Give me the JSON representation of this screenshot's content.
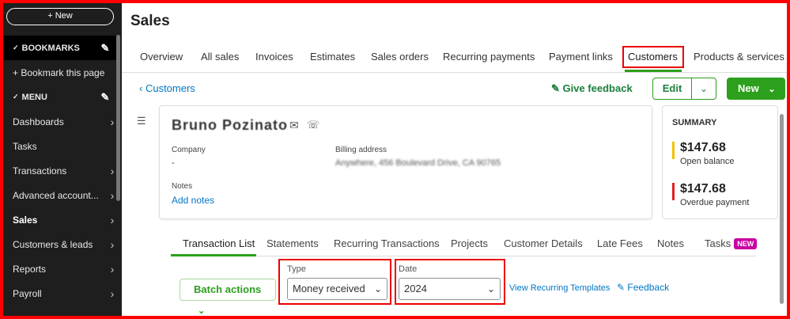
{
  "sidebar": {
    "new_label": "+ New",
    "bookmarks_label": "BOOKMARKS",
    "bookmark_page_label": "+ Bookmark this page",
    "menu_label": "MENU",
    "items": [
      {
        "label": "Dashboards",
        "chevron": true
      },
      {
        "label": "Tasks",
        "chevron": false
      },
      {
        "label": "Transactions",
        "chevron": true
      },
      {
        "label": "Advanced account...",
        "chevron": true
      },
      {
        "label": "Sales",
        "chevron": true,
        "active": true
      },
      {
        "label": "Customers & leads",
        "chevron": true
      },
      {
        "label": "Reports",
        "chevron": true
      },
      {
        "label": "Payroll",
        "chevron": true
      }
    ]
  },
  "page": {
    "title": "Sales"
  },
  "tabs": [
    "Overview",
    "All sales",
    "Invoices",
    "Estimates",
    "Sales orders",
    "Recurring payments",
    "Payment links",
    "Customers",
    "Products & services"
  ],
  "active_tab": "Customers",
  "header_actions": {
    "back_label": "Customers",
    "feedback_label": "Give feedback",
    "edit_label": "Edit",
    "new_label": "New"
  },
  "customer": {
    "name": "Bruno Pozinato",
    "company_label": "Company",
    "company_value": "-",
    "billing_label": "Billing address",
    "billing_value": "Anywhere, 456 Boulevard Drive, CA 90765",
    "notes_label": "Notes",
    "add_notes_label": "Add notes"
  },
  "summary": {
    "title": "SUMMARY",
    "open_amount": "$147.68",
    "open_label": "Open balance",
    "overdue_amount": "$147.68",
    "overdue_label": "Overdue payment",
    "open_color": "#f2c000",
    "overdue_color": "#e02020"
  },
  "subtabs": [
    "Transaction List",
    "Statements",
    "Recurring Transactions",
    "Projects",
    "Customer Details",
    "Late Fees",
    "Notes",
    "Tasks"
  ],
  "new_badge": "NEW",
  "filters": {
    "batch_label": "Batch actions",
    "type_label": "Type",
    "type_value": "Money received",
    "date_label": "Date",
    "date_value": "2024",
    "recurring_link": "View Recurring Templates",
    "feedback_label": "Feedback"
  },
  "colors": {
    "accent": "#2ca01c",
    "link": "#0077c5",
    "highlight": "#e00000"
  }
}
